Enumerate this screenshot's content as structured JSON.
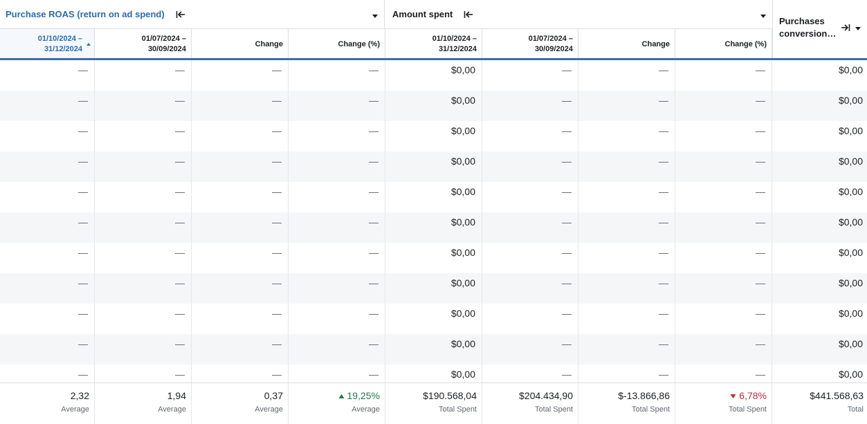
{
  "groups": [
    {
      "title": "Purchase ROAS (return on ad spend)",
      "blue": true
    },
    {
      "title": "Amount spent",
      "blue": false
    }
  ],
  "last_column": {
    "title": "Purchases conversion…"
  },
  "columns": [
    "01/10/2024 – 31/12/2024",
    "01/07/2024 – 30/09/2024",
    "Change",
    "Change (%)",
    "01/10/2024 – 31/12/2024",
    "01/07/2024 – 30/09/2024",
    "Change",
    "Change (%)"
  ],
  "rows": [
    [
      "—",
      "—",
      "—",
      "—",
      "$0,00",
      "—",
      "—",
      "—",
      "$0,00"
    ],
    [
      "—",
      "—",
      "—",
      "—",
      "$0,00",
      "—",
      "—",
      "—",
      "$0,00"
    ],
    [
      "—",
      "—",
      "—",
      "—",
      "$0,00",
      "—",
      "—",
      "—",
      "$0,00"
    ],
    [
      "—",
      "—",
      "—",
      "—",
      "$0,00",
      "—",
      "—",
      "—",
      "$0,00"
    ],
    [
      "—",
      "—",
      "—",
      "—",
      "$0,00",
      "—",
      "—",
      "—",
      "$0,00"
    ],
    [
      "—",
      "—",
      "—",
      "—",
      "$0,00",
      "—",
      "—",
      "—",
      "$0,00"
    ],
    [
      "—",
      "—",
      "—",
      "—",
      "$0,00",
      "—",
      "—",
      "—",
      "$0,00"
    ],
    [
      "—",
      "—",
      "—",
      "—",
      "$0,00",
      "—",
      "—",
      "—",
      "$0,00"
    ],
    [
      "—",
      "—",
      "—",
      "—",
      "$0,00",
      "—",
      "—",
      "—",
      "$0,00"
    ],
    [
      "—",
      "—",
      "—",
      "—",
      "$0,00",
      "—",
      "—",
      "—",
      "$0,00"
    ],
    [
      "—",
      "—",
      "—",
      "—",
      "$0,00",
      "—",
      "—",
      "—",
      "$0,00"
    ]
  ],
  "footer": [
    {
      "value": "2,32",
      "label": "Average",
      "trend": ""
    },
    {
      "value": "1,94",
      "label": "Average",
      "trend": ""
    },
    {
      "value": "0,37",
      "label": "Average",
      "trend": ""
    },
    {
      "value": "19,25%",
      "label": "Average",
      "trend": "up"
    },
    {
      "value": "$190.568,04",
      "label": "Total Spent",
      "trend": ""
    },
    {
      "value": "$204.434,90",
      "label": "Total Spent",
      "trend": ""
    },
    {
      "value": "$-13.866,86",
      "label": "Total Spent",
      "trend": ""
    },
    {
      "value": "6,78%",
      "label": "Total Spent",
      "trend": "down"
    },
    {
      "value": "$441.568,63",
      "label": "Total",
      "trend": ""
    }
  ],
  "colors": {
    "accent": "#2b6cb0",
    "header_bar": "#3b6ea8",
    "up": "#1f7a4c",
    "down": "#c2283b"
  },
  "icons": {
    "collapse": "collapse-left-icon",
    "dropdown": "caret-down-icon",
    "expand": "expand-right-icon",
    "sort": "sort-asc-icon"
  }
}
